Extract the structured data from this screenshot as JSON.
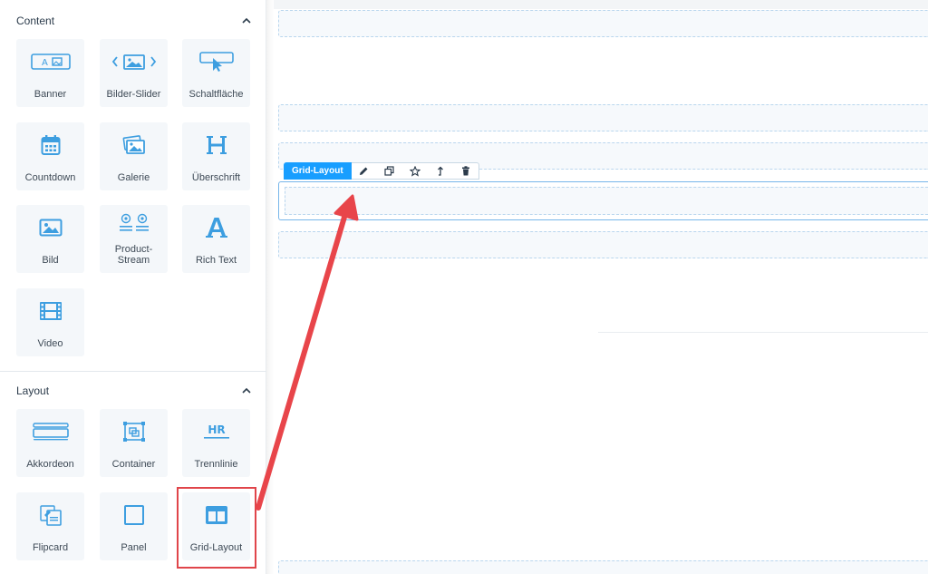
{
  "sidebar": {
    "content_section": {
      "title": "Content",
      "items": [
        {
          "label": "Banner",
          "icon": "banner-icon"
        },
        {
          "label": "Bilder-Slider",
          "icon": "image-slider-icon"
        },
        {
          "label": "Schaltfläche",
          "icon": "button-cursor-icon"
        },
        {
          "label": "Countdown",
          "icon": "calendar-icon"
        },
        {
          "label": "Galerie",
          "icon": "gallery-icon"
        },
        {
          "label": "Überschrift",
          "icon": "heading-icon"
        },
        {
          "label": "Bild",
          "icon": "image-icon"
        },
        {
          "label": "Product-",
          "label2": "Stream",
          "icon": "product-stream-icon"
        },
        {
          "label": "Rich Text",
          "icon": "rich-text-icon"
        },
        {
          "label": "Video",
          "icon": "film-icon"
        }
      ]
    },
    "layout_section": {
      "title": "Layout",
      "items": [
        {
          "label": "Akkordeon",
          "icon": "accordion-icon"
        },
        {
          "label": "Container",
          "icon": "container-icon"
        },
        {
          "label": "Trennlinie",
          "icon": "hr-divider-icon",
          "icon_text": "HR"
        },
        {
          "label": "Flipcard",
          "icon": "flipcard-icon"
        },
        {
          "label": "Panel",
          "icon": "panel-icon"
        },
        {
          "label": "Grid-Layout",
          "icon": "grid-layout-icon"
        }
      ]
    }
  },
  "canvas": {
    "selected_element_label": "Grid-Layout",
    "toolbar_actions": [
      "edit-icon",
      "duplicate-icon",
      "star-icon",
      "move-up-icon",
      "delete-icon"
    ]
  },
  "colors": {
    "accent": "#189eff",
    "icon_blue": "#3d9ee0",
    "annotation_red": "#e8454a"
  }
}
